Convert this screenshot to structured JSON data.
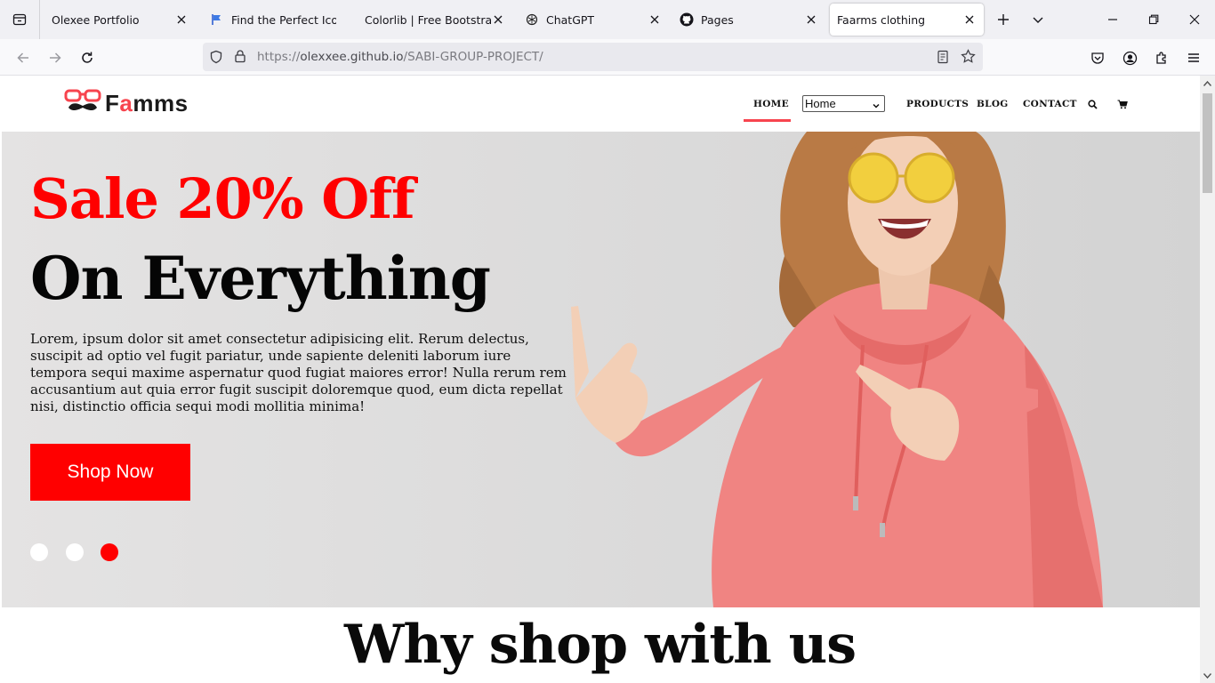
{
  "browser": {
    "tabs": [
      {
        "title": "Olexee Portfolio",
        "favicon": "none"
      },
      {
        "title": "Find the Perfect Icon fo",
        "favicon": "flag-icon"
      },
      {
        "title": "Colorlib | Free Bootstrap W",
        "favicon": "none"
      },
      {
        "title": "ChatGPT",
        "favicon": "chatgpt-icon"
      },
      {
        "title": "Pages",
        "favicon": "github-icon"
      },
      {
        "title": "Faarms clothing",
        "favicon": "none",
        "active": true
      }
    ],
    "url": {
      "scheme": "https://",
      "host": "olexxee.github.io",
      "path": "/SABI-GROUP-PROJECT/"
    }
  },
  "site": {
    "logo": {
      "brand_prefix": "F",
      "brand_accent": "a",
      "brand_suffix": "mms"
    },
    "menu": {
      "home": "HOME",
      "select_value": "Home",
      "products": "PRODUCTS",
      "blog": "BLOG",
      "contact": "CONTACT"
    },
    "hero": {
      "headline_red": "Sale 20% Off",
      "headline_black": "On Everything",
      "description": "Lorem, ipsum dolor sit amet consectetur adipisicing elit. Rerum delectus, suscipit ad optio vel fugit pariatur, unde sapiente deleniti laborum iure tempora sequi maxime aspernatur quod fugiat maiores error! Nulla rerum rem accusantium aut quia error fugit suscipit doloremque quod, eum dicta repellat nisi, distinctio officia sequi modi mollitia minima!",
      "cta": "Shop Now",
      "carousel_active_index": 2,
      "carousel_count": 3
    },
    "why_title": "Why shop with us"
  },
  "colors": {
    "accent_red": "#ff0000",
    "menu_underline": "#f7444e",
    "hero_bg": "#e4e3e3",
    "hoodie_pink": "#f08482"
  }
}
